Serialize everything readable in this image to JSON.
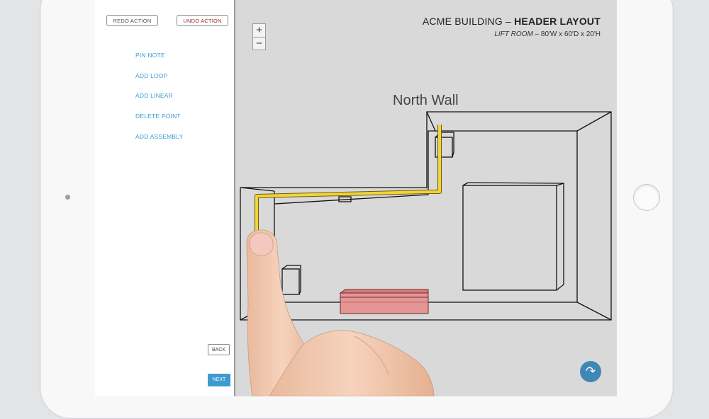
{
  "panel": {
    "redo_label": "REDO ACTION",
    "undo_label": "UNDO ACTION",
    "menu": [
      "PIN NOTE",
      "ADD LOOP",
      "ADD LINEAR",
      "DELETE POINT",
      "ADD ASSEMBLY"
    ],
    "back_label": "BACK",
    "next_label": "NEXT"
  },
  "canvas": {
    "zoom_in": "+",
    "zoom_out": "−",
    "title_prefix": "ACME BUILDING – ",
    "title_bold": "HEADER LAYOUT",
    "subtitle_italic": "LIFT ROOM",
    "subtitle_rest": " – 80'W x 60'D x 20'H",
    "wall_label": "North Wall",
    "undo_icon": "↶",
    "redo_icon": "↷"
  },
  "colors": {
    "accent": "#3a9ed2",
    "undo_text": "#9b2d2d",
    "route_line": "#e8c92a",
    "highlight_box": "#e58a8a"
  }
}
